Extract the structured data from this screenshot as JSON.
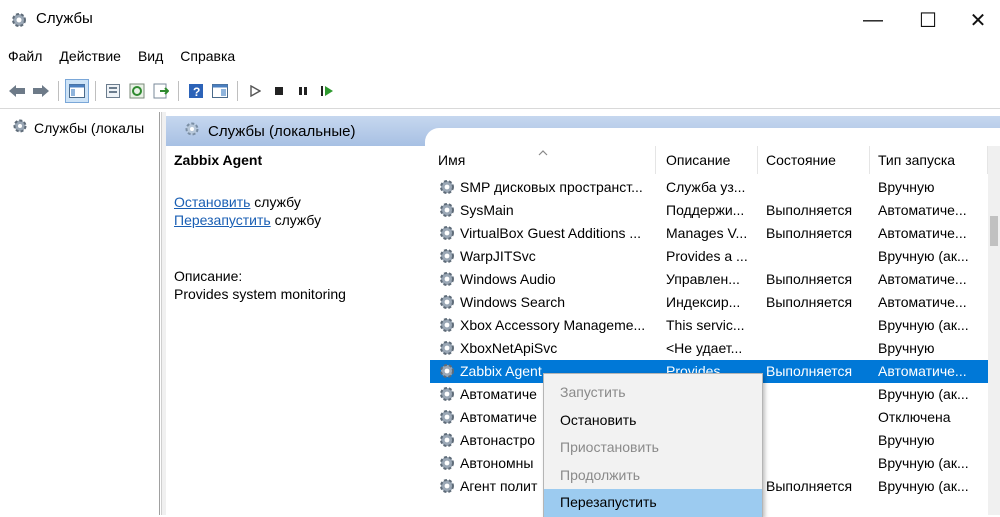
{
  "window": {
    "title": "Службы",
    "minimize": "—",
    "maximize": "☐",
    "close": "✕"
  },
  "menu": [
    "Файл",
    "Действие",
    "Вид",
    "Справка"
  ],
  "tree": {
    "item": "Службы (локалы"
  },
  "panel": {
    "tab_label": "Службы (локальные)"
  },
  "details": {
    "title": "Zabbix Agent",
    "stop_link": "Остановить",
    "stop_suffix": " службу",
    "restart_link": "Перезапустить",
    "restart_suffix": " службу",
    "desc_label": "Описание:",
    "desc_text": "Provides system monitoring"
  },
  "columns": {
    "name": "Имя",
    "description": "Описание",
    "state": "Состояние",
    "startup": "Тип запуска"
  },
  "rows": [
    {
      "name": "SMP дисковых пространст...",
      "description": "Служба уз...",
      "state": "",
      "startup": "Вручную"
    },
    {
      "name": "SysMain",
      "description": "Поддержи...",
      "state": "Выполняется",
      "startup": "Автоматиче..."
    },
    {
      "name": "VirtualBox Guest Additions ...",
      "description": "Manages V...",
      "state": "Выполняется",
      "startup": "Автоматиче..."
    },
    {
      "name": "WarpJITSvc",
      "description": "Provides a ...",
      "state": "",
      "startup": "Вручную (ак..."
    },
    {
      "name": "Windows Audio",
      "description": "Управлен...",
      "state": "Выполняется",
      "startup": "Автоматиче..."
    },
    {
      "name": "Windows Search",
      "description": "Индексир...",
      "state": "Выполняется",
      "startup": "Автоматиче..."
    },
    {
      "name": "Xbox Accessory Manageme...",
      "description": "This servic...",
      "state": "",
      "startup": "Вручную (ак..."
    },
    {
      "name": "XboxNetApiSvc",
      "description": "<Не удает...",
      "state": "",
      "startup": "Вручную"
    },
    {
      "name": "Zabbix Agent",
      "description": "Provides ...",
      "state": "Выполняется",
      "startup": "Автоматиче...",
      "selected": true
    },
    {
      "name": "Автоматиче",
      "description": "",
      "state": "",
      "startup": "Вручную (ак..."
    },
    {
      "name": "Автоматиче",
      "description": "",
      "state": "",
      "startup": "Отключена"
    },
    {
      "name": "Автонастро",
      "description": "",
      "state": "",
      "startup": "Вручную"
    },
    {
      "name": "Автономны",
      "description": "",
      "state": "",
      "startup": "Вручную (ак..."
    },
    {
      "name": "Агент полит",
      "description": "",
      "state": "Выполняется",
      "startup": "Вручную (ак..."
    }
  ],
  "context_menu": [
    {
      "label": "Запустить",
      "disabled": true
    },
    {
      "label": "Остановить",
      "disabled": false
    },
    {
      "label": "Приостановить",
      "disabled": true
    },
    {
      "label": "Продолжить",
      "disabled": true
    },
    {
      "label": "Перезапустить",
      "disabled": false,
      "highlighted": true
    }
  ],
  "colors": {
    "selection": "#0078d7",
    "menu_highlight": "#9ccbf0",
    "link": "#1a5fb4",
    "header_blue": "#b6cbe9"
  }
}
